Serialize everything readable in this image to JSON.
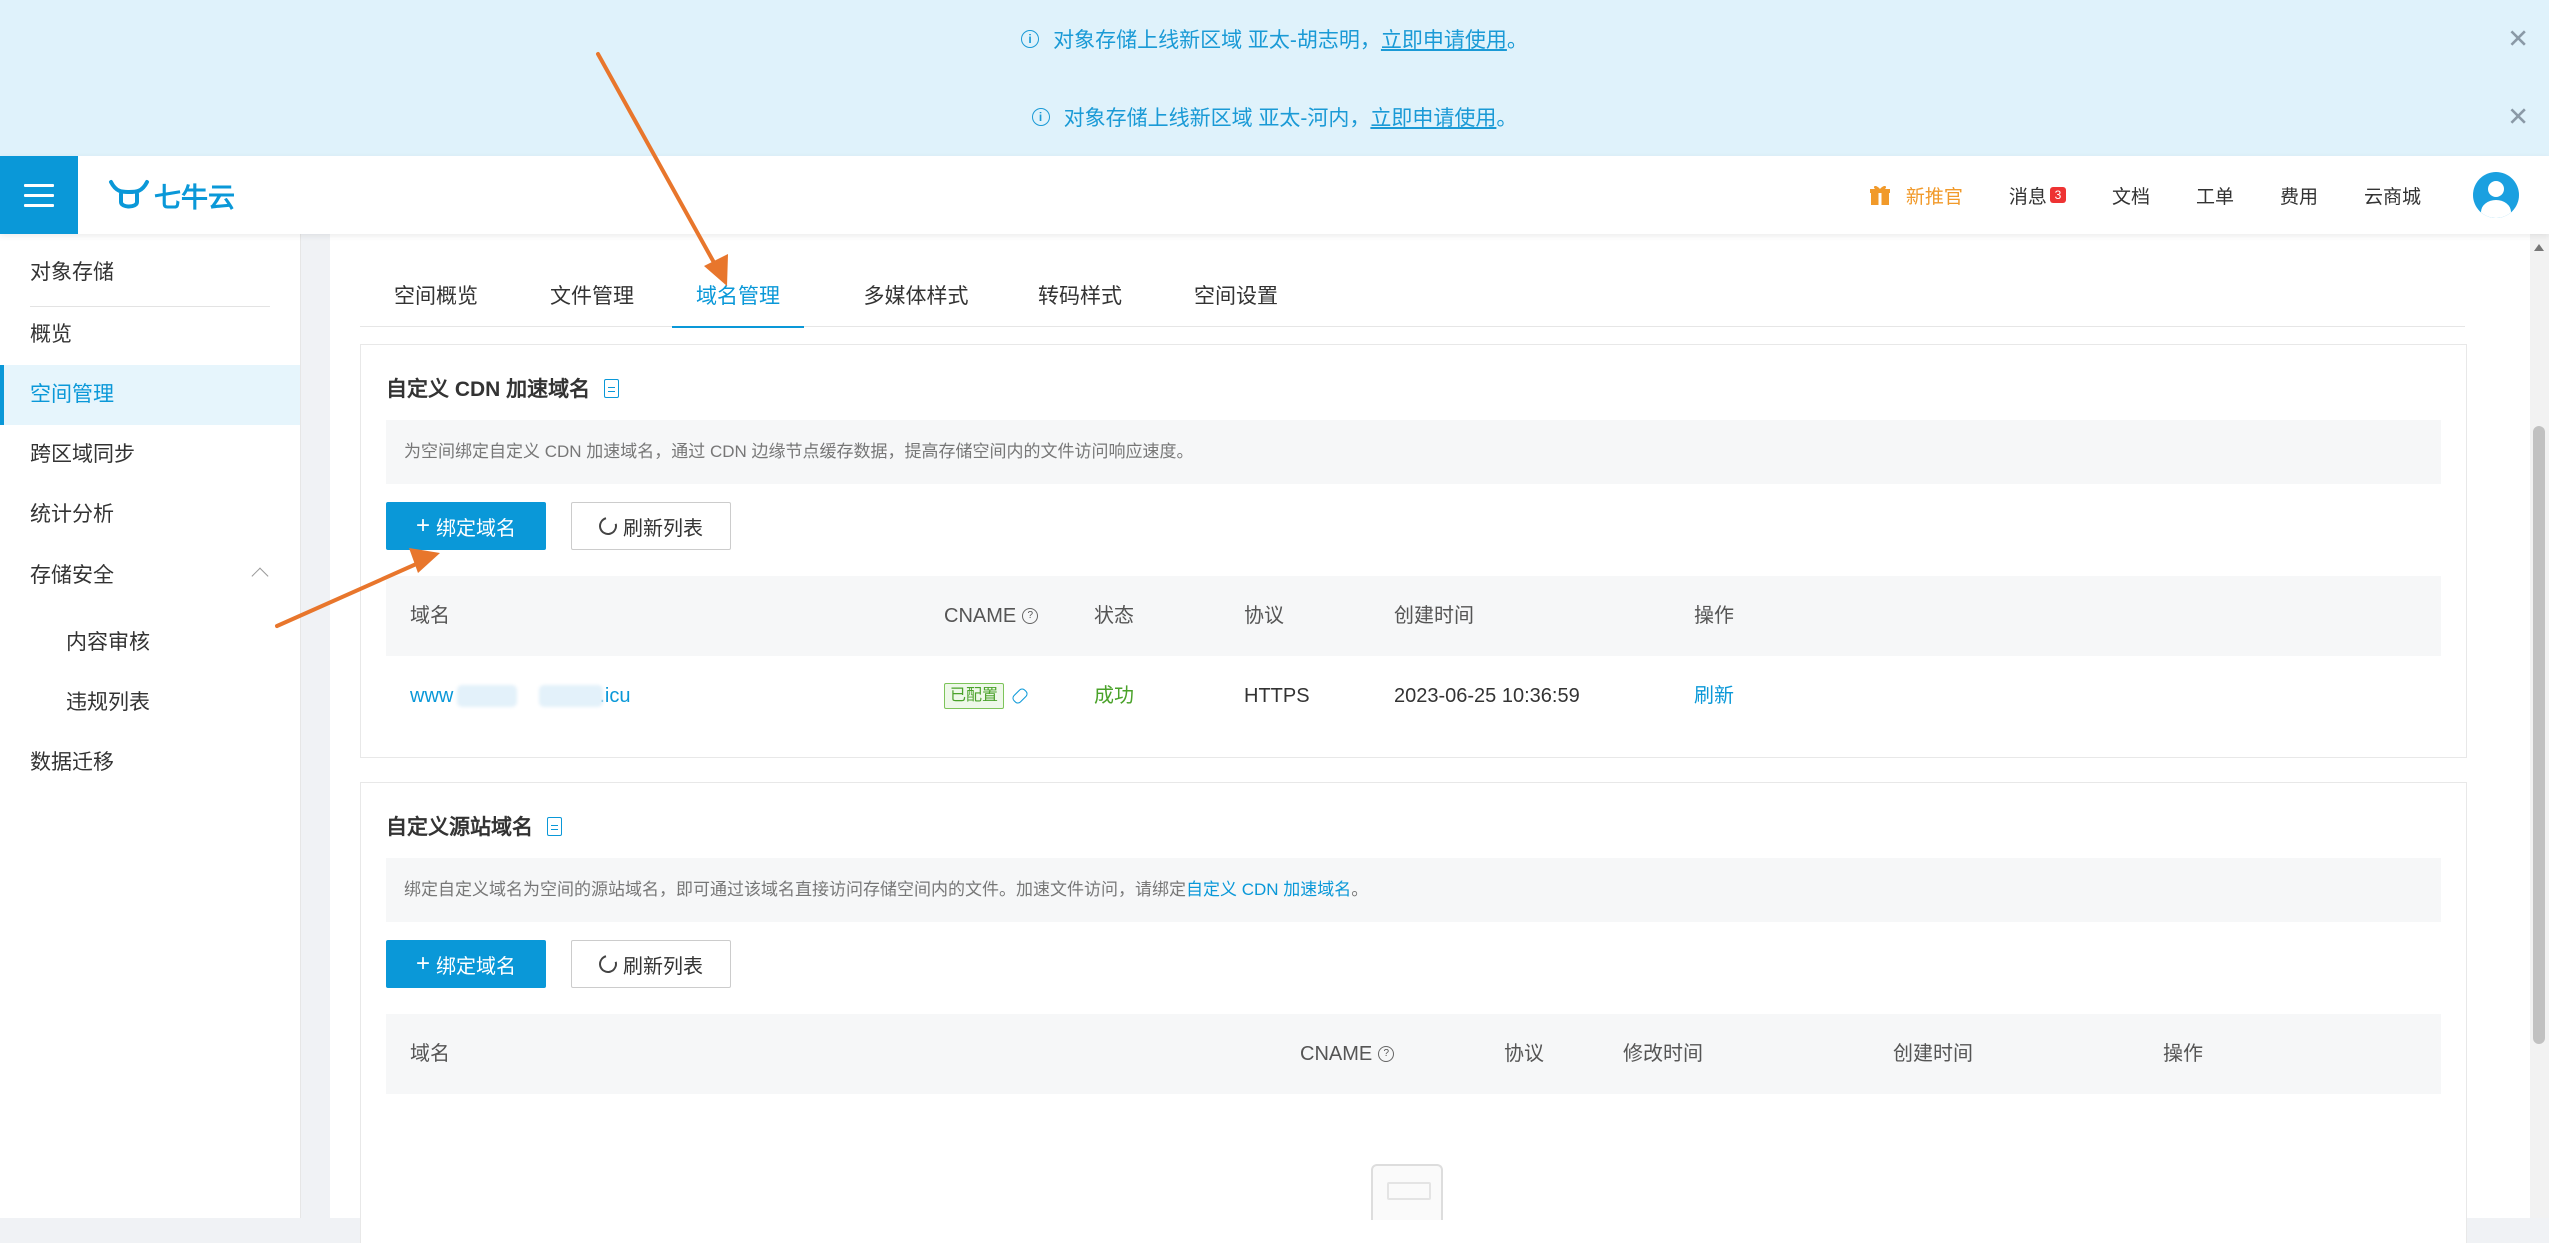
{
  "notices": [
    {
      "text": "对象存储上线新区域 亚太-胡志明，",
      "link": "立即申请使用",
      "suffix": "。"
    },
    {
      "text": "对象存储上线新区域 亚太-河内，",
      "link": "立即申请使用",
      "suffix": "。"
    }
  ],
  "header": {
    "logo_text": "七牛云",
    "nav": {
      "recommend": "新推官",
      "messages": "消息",
      "messages_count": "3",
      "docs": "文档",
      "tickets": "工单",
      "billing": "费用",
      "marketplace": "云商城"
    }
  },
  "sidebar": {
    "title": "对象存储",
    "items": [
      {
        "label": "概览"
      },
      {
        "label": "空间管理"
      },
      {
        "label": "跨区域同步"
      },
      {
        "label": "统计分析"
      },
      {
        "label": "存储安全"
      },
      {
        "label": "内容审核"
      },
      {
        "label": "违规列表"
      },
      {
        "label": "数据迁移"
      }
    ]
  },
  "tabs": [
    {
      "label": "空间概览"
    },
    {
      "label": "文件管理"
    },
    {
      "label": "域名管理"
    },
    {
      "label": "多媒体样式"
    },
    {
      "label": "转码样式"
    },
    {
      "label": "空间设置"
    }
  ],
  "cdn_section": {
    "title": "自定义 CDN 加速域名",
    "description": "为空间绑定自定义 CDN 加速域名，通过 CDN 边缘节点缓存数据，提高存储空间内的文件访问响应速度。",
    "bind_button": "绑定域名",
    "refresh_button": "刷新列表",
    "columns": {
      "domain": "域名",
      "cname": "CNAME",
      "status": "状态",
      "protocol": "协议",
      "created": "创建时间",
      "actions": "操作"
    },
    "rows": [
      {
        "domain_prefix": "www",
        "domain_suffix": ".icu",
        "cname_tag": "已配置",
        "status": "成功",
        "protocol": "HTTPS",
        "created": "2023-06-25 10:36:59",
        "action": "刷新"
      }
    ]
  },
  "origin_section": {
    "title": "自定义源站域名",
    "description": "绑定自定义域名为空间的源站域名，即可通过该域名直接访问存储空间内的文件。加速文件访问，请绑定",
    "description_link": "自定义 CDN 加速域名",
    "description_end": "。",
    "bind_button": "绑定域名",
    "refresh_button": "刷新列表",
    "columns": {
      "domain": "域名",
      "cname": "CNAME",
      "protocol": "协议",
      "modified": "修改时间",
      "created": "创建时间",
      "actions": "操作"
    }
  },
  "colors": {
    "accent": "#0a98d8",
    "notice_bg": "#dff2fb",
    "success": "#4aa22a",
    "annotation_arrow": "#e8762c"
  }
}
